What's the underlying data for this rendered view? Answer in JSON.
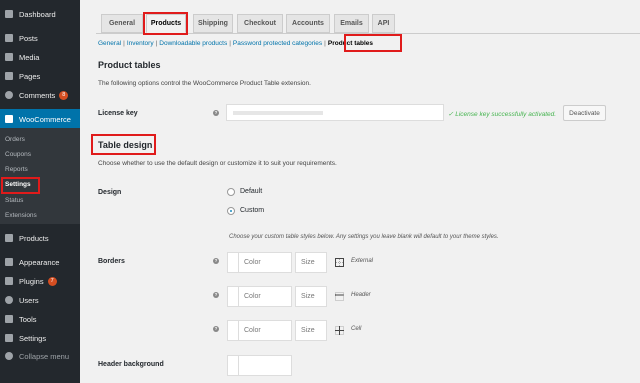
{
  "sidebar": {
    "items": [
      {
        "label": "Dashboard",
        "icon": "dashboard-icon"
      },
      {
        "label": "Posts",
        "icon": "pin-icon"
      },
      {
        "label": "Media",
        "icon": "media-icon"
      },
      {
        "label": "Pages",
        "icon": "pages-icon"
      },
      {
        "label": "Comments",
        "icon": "comments-icon",
        "badge": "8"
      },
      {
        "label": "WooCommerce",
        "icon": "woo-icon"
      },
      {
        "label": "Products",
        "icon": "products-icon"
      },
      {
        "label": "Appearance",
        "icon": "brush-icon"
      },
      {
        "label": "Plugins",
        "icon": "plugin-icon",
        "badge": "7"
      },
      {
        "label": "Users",
        "icon": "users-icon"
      },
      {
        "label": "Tools",
        "icon": "wrench-icon"
      },
      {
        "label": "Settings",
        "icon": "settings-icon"
      },
      {
        "label": "Collapse menu",
        "icon": "collapse-icon"
      }
    ],
    "woo_sub": [
      "Orders",
      "Coupons",
      "Reports",
      "Settings",
      "Status",
      "Extensions"
    ]
  },
  "tabs": [
    "General",
    "Products",
    "Shipping",
    "Checkout",
    "Accounts",
    "Emails",
    "API"
  ],
  "subnav": [
    "General",
    "Inventory",
    "Downloadable products",
    "Password protected categories",
    "Product tables"
  ],
  "section": {
    "title": "Product tables",
    "desc": "The following options control the WooCommerce Product Table extension."
  },
  "license": {
    "label": "License key",
    "status": "✓ License key successfully activated.",
    "button": "Deactivate"
  },
  "design": {
    "title": "Table design",
    "desc": "Choose whether to use the default design or customize it to suit your requirements.",
    "label": "Design",
    "options": [
      "Default",
      "Custom"
    ],
    "note": "Choose your custom table styles below. Any settings you leave blank will default to your theme styles."
  },
  "borders": {
    "label": "Borders",
    "rows": [
      {
        "color": "Color",
        "size": "Size",
        "type": "External"
      },
      {
        "color": "Color",
        "size": "Size",
        "type": "Header"
      },
      {
        "color": "Color",
        "size": "Size",
        "type": "Cell"
      }
    ]
  },
  "header_bg": {
    "label": "Header background"
  },
  "colors": {
    "accent": "#0073aa",
    "highlight": "#e01b1b",
    "success": "#46b450",
    "sidebar": "#23282d"
  }
}
